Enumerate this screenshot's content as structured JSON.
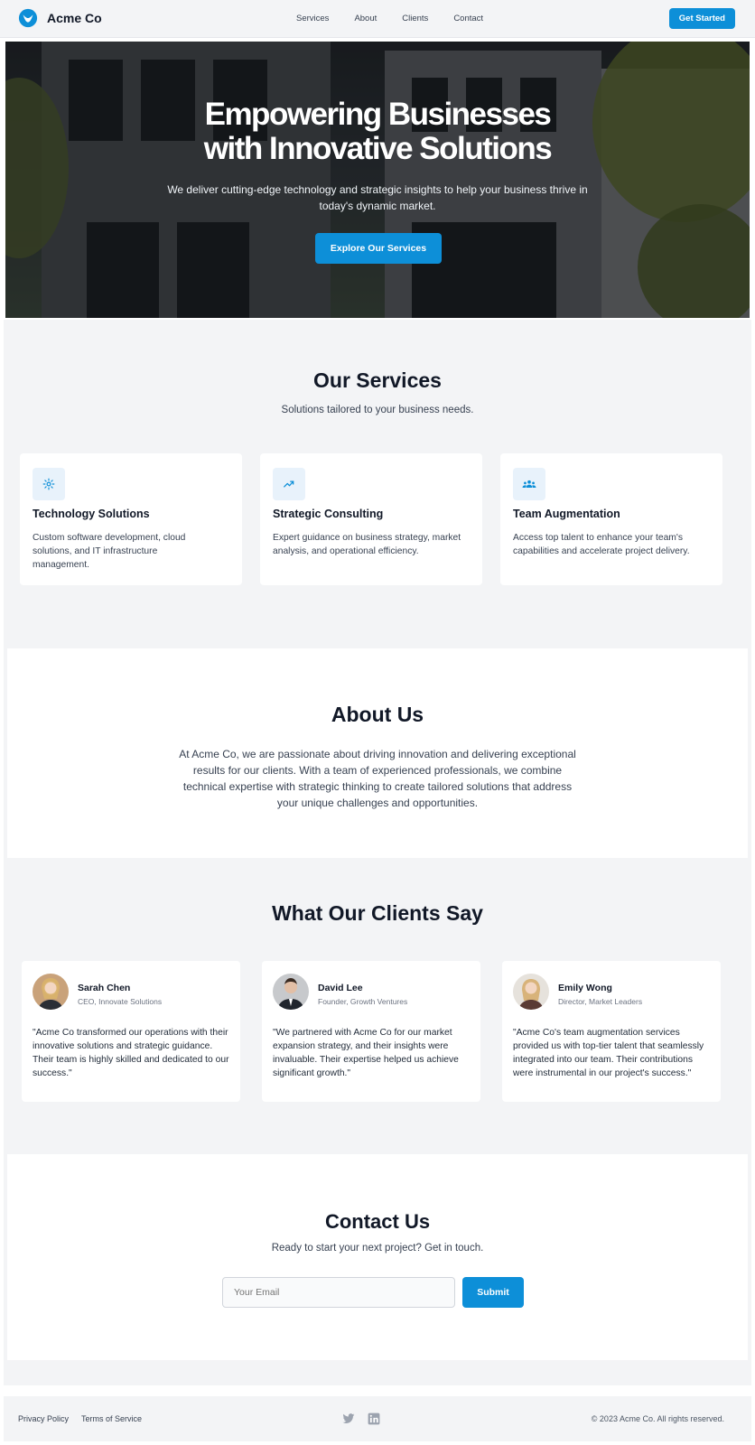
{
  "header": {
    "brand": "Acme Co",
    "nav": [
      "Services",
      "About",
      "Clients",
      "Contact"
    ],
    "cta": "Get Started"
  },
  "hero": {
    "title_line1": "Empowering Businesses",
    "title_line2": "with Innovative Solutions",
    "subtitle": "We deliver cutting-edge technology and strategic insights to help your business thrive in today's dynamic market.",
    "button": "Explore Our Services"
  },
  "services": {
    "title": "Our Services",
    "subtitle": "Solutions tailored to your business needs.",
    "items": [
      {
        "icon": "gear-icon",
        "title": "Technology Solutions",
        "description": "Custom software development, cloud solutions, and IT infrastructure management."
      },
      {
        "icon": "trend-chart-icon",
        "title": "Strategic Consulting",
        "description": "Expert guidance on business strategy, market analysis, and operational efficiency."
      },
      {
        "icon": "team-icon",
        "title": "Team Augmentation",
        "description": "Access top talent to enhance your team's capabilities and accelerate project delivery."
      }
    ]
  },
  "about": {
    "title": "About Us",
    "text": "At Acme Co, we are passionate about driving innovation and delivering exceptional results for our clients. With a team of experienced professionals, we combine technical expertise with strategic thinking to create tailored solutions that address your unique challenges and opportunities."
  },
  "testimonials": {
    "title": "What Our Clients Say",
    "items": [
      {
        "name": "Sarah Chen",
        "role": "CEO, Innovate Solutions",
        "quote": "\"Acme Co transformed our operations with their innovative solutions and strategic guidance. Their team is highly skilled and dedicated to our success.\""
      },
      {
        "name": "David Lee",
        "role": "Founder, Growth Ventures",
        "quote": "\"We partnered with Acme Co for our market expansion strategy, and their insights were invaluable. Their expertise helped us achieve significant growth.\""
      },
      {
        "name": "Emily Wong",
        "role": "Director, Market Leaders",
        "quote": "\"Acme Co's team augmentation services provided us with top-tier talent that seamlessly integrated into our team. Their contributions were instrumental in our project's success.\""
      }
    ]
  },
  "contact": {
    "title": "Contact Us",
    "subtitle": "Ready to start your next project? Get in touch.",
    "email_placeholder": "Your Email",
    "submit": "Submit"
  },
  "footer": {
    "links": [
      "Privacy Policy",
      "Terms of Service"
    ],
    "social": [
      "twitter-icon",
      "linkedin-icon"
    ],
    "copyright": "© 2023 Acme Co. All rights reserved."
  },
  "colors": {
    "accent": "#0d8fd8",
    "page_bg": "#f3f4f6"
  }
}
